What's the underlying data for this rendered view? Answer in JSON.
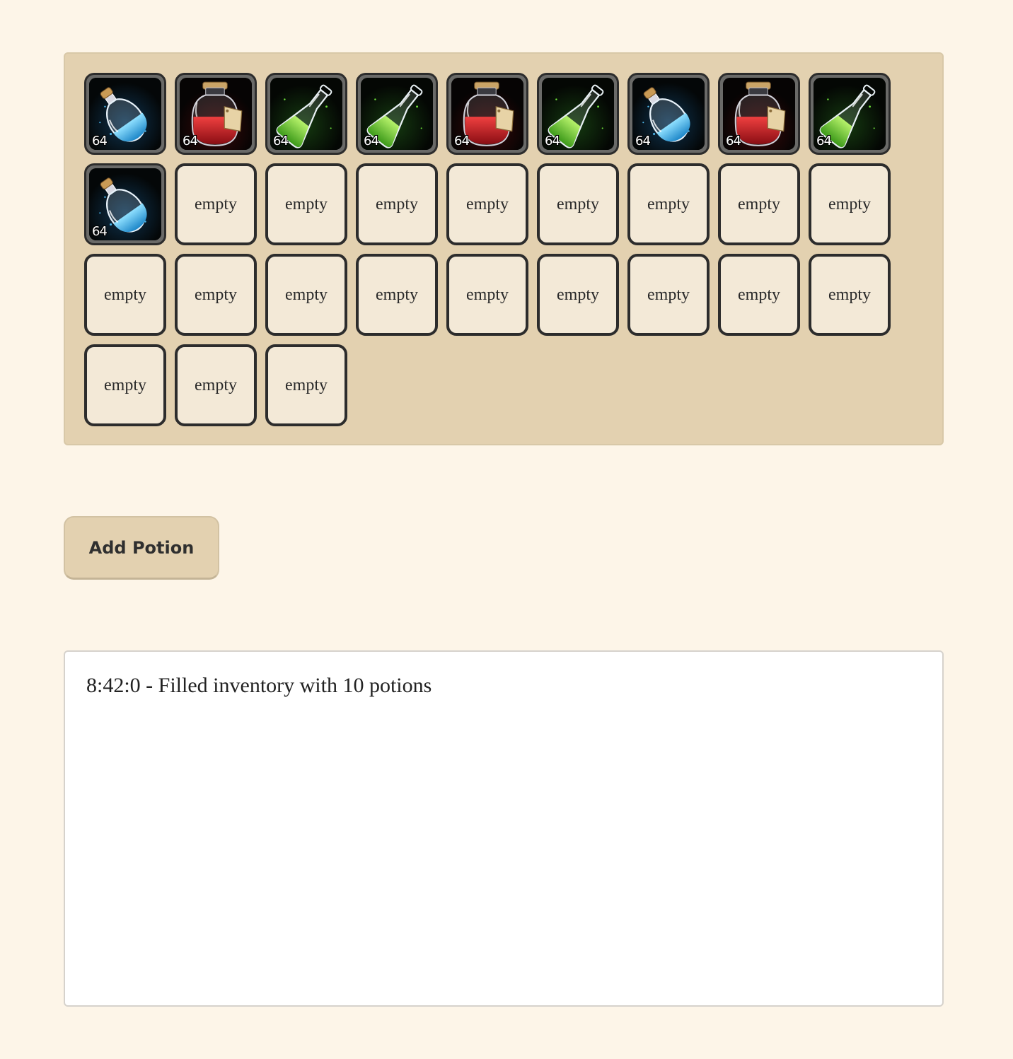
{
  "inventory": {
    "slots": [
      {
        "state": "filled",
        "potion": "blue-potion-icon",
        "count": "64"
      },
      {
        "state": "filled",
        "potion": "red-potion-icon",
        "count": "64"
      },
      {
        "state": "filled",
        "potion": "green-potion-icon",
        "count": "64"
      },
      {
        "state": "filled",
        "potion": "green-potion-icon",
        "count": "64"
      },
      {
        "state": "filled",
        "potion": "red-potion-icon",
        "count": "64"
      },
      {
        "state": "filled",
        "potion": "green-potion-icon",
        "count": "64"
      },
      {
        "state": "filled",
        "potion": "blue-potion-icon",
        "count": "64"
      },
      {
        "state": "filled",
        "potion": "red-potion-icon",
        "count": "64"
      },
      {
        "state": "filled",
        "potion": "green-potion-icon",
        "count": "64"
      },
      {
        "state": "filled",
        "potion": "blue-potion-icon",
        "count": "64"
      },
      {
        "state": "empty",
        "label": "empty"
      },
      {
        "state": "empty",
        "label": "empty"
      },
      {
        "state": "empty",
        "label": "empty"
      },
      {
        "state": "empty",
        "label": "empty"
      },
      {
        "state": "empty",
        "label": "empty"
      },
      {
        "state": "empty",
        "label": "empty"
      },
      {
        "state": "empty",
        "label": "empty"
      },
      {
        "state": "empty",
        "label": "empty"
      },
      {
        "state": "empty",
        "label": "empty"
      },
      {
        "state": "empty",
        "label": "empty"
      },
      {
        "state": "empty",
        "label": "empty"
      },
      {
        "state": "empty",
        "label": "empty"
      },
      {
        "state": "empty",
        "label": "empty"
      },
      {
        "state": "empty",
        "label": "empty"
      },
      {
        "state": "empty",
        "label": "empty"
      },
      {
        "state": "empty",
        "label": "empty"
      },
      {
        "state": "empty",
        "label": "empty"
      },
      {
        "state": "empty",
        "label": "empty"
      },
      {
        "state": "empty",
        "label": "empty"
      },
      {
        "state": "empty",
        "label": "empty"
      }
    ]
  },
  "controls": {
    "add_potion_label": "Add Potion"
  },
  "log": {
    "entries": [
      "8:42:0 - Filled inventory with 10 potions"
    ]
  },
  "colors": {
    "page_background": "#fdf5e8",
    "panel_background": "#e3d1b0",
    "empty_slot": "#f3e9d7",
    "slot_border": "#2c2c2c",
    "blue_liquid": "#3fb2e6",
    "red_liquid": "#c8202a",
    "green_liquid": "#5fd02e"
  }
}
